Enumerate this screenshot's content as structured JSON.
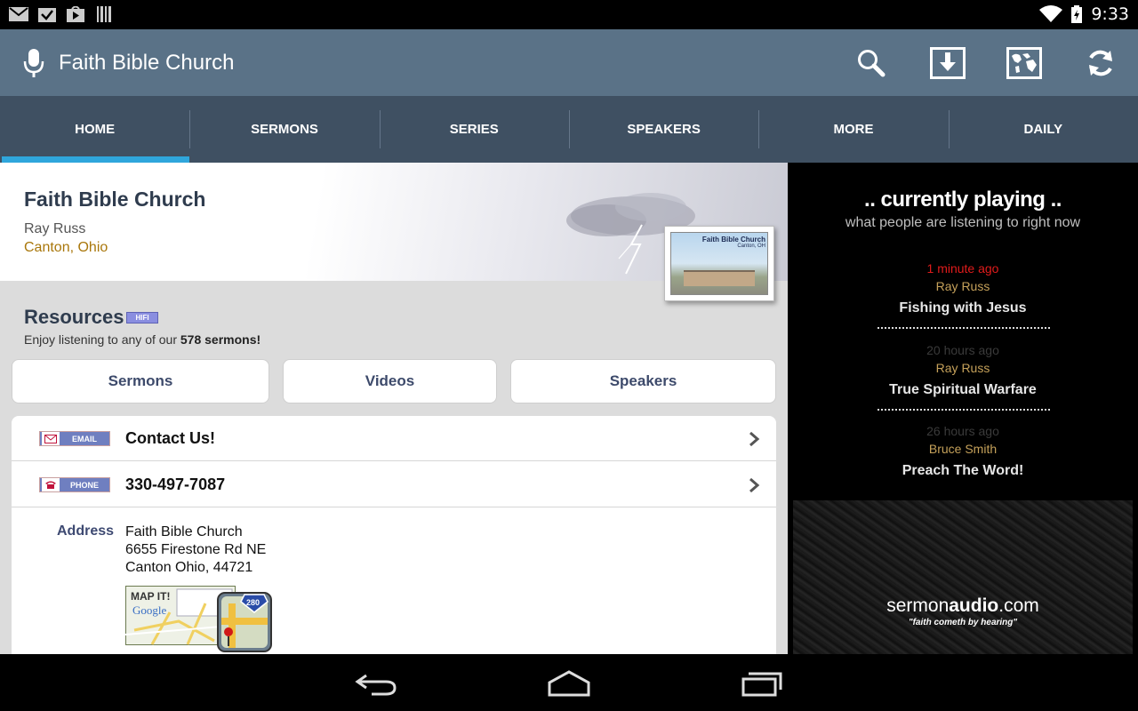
{
  "status": {
    "time": "9:33"
  },
  "app": {
    "title": "Faith Bible Church"
  },
  "actions": {
    "search": "search-icon",
    "download": "download-icon",
    "map": "world-map-icon",
    "refresh": "refresh-icon"
  },
  "tabs": [
    "HOME",
    "SERMONS",
    "SERIES",
    "SPEAKERS",
    "MORE",
    "DAILY"
  ],
  "header": {
    "name": "Faith Bible Church",
    "speaker": "Ray Russ",
    "location": "Canton, Ohio",
    "thumb_caption": "Faith Bible Church",
    "thumb_sub": "Canton, OH"
  },
  "resources": {
    "title": "Resources",
    "badge": "HIFI",
    "subtitle_prefix": "Enjoy listening to any of our ",
    "count": "578 sermons!",
    "buttons": [
      "Sermons",
      "Videos",
      "Speakers"
    ]
  },
  "contact": {
    "email_badge": "EMAIL",
    "email_label": "Contact Us!",
    "phone_badge": "PHONE",
    "phone": "330-497-7087",
    "address_label": "Address",
    "address": [
      "Faith Bible Church",
      "6655 Firestone Rd NE",
      "Canton Ohio, 44721"
    ],
    "map_text": "MAP IT!",
    "map_google": "Google",
    "map_route": "280"
  },
  "playing": {
    "title": ".. currently playing ..",
    "subtitle": "what people are listening to right now",
    "items": [
      {
        "time": "1 minute ago",
        "speaker": "Ray Russ",
        "title": "Fishing with Jesus",
        "time_color": "#e01b1b"
      },
      {
        "time": "20 hours ago",
        "speaker": "Ray Russ",
        "title": "True Spiritual Warfare",
        "time_color": "#3a3a3a"
      },
      {
        "time": "26 hours ago",
        "speaker": "Bruce Smith",
        "title": "Preach The Word!",
        "time_color": "#3a3a3a"
      }
    ]
  },
  "brand": {
    "logo_a": "sermon",
    "logo_b": "audio",
    "logo_c": ".com",
    "tagline": "\"faith cometh by hearing\""
  },
  "colors": {
    "actionbar": "#5a7287",
    "tabs": "#3f5062",
    "tab_indicator": "#2fa6dc",
    "accent_location": "#a9770b"
  }
}
